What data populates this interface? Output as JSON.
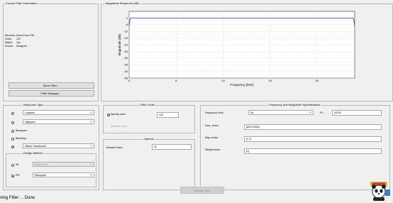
{
  "current_filter": {
    "title": "Current Filter Information",
    "rows": [
      {
        "key": "Structure:",
        "value": "Direct-Form FIR"
      },
      {
        "key": "Order:",
        "value": "120"
      },
      {
        "key": "Stable:",
        "value": "Yes"
      },
      {
        "key": "Source:",
        "value": "Designed"
      }
    ],
    "store_filter": "Store Filter ...",
    "filter_manager": "Filter Manager ..."
  },
  "magnitude": {
    "title": "Magnitude Response (dB)",
    "chart_data": {
      "type": "line",
      "xlabel": "Frequency (kHz)",
      "ylabel": "Magnitude (dB)",
      "xlim": [
        0,
        24
      ],
      "ylim": [
        -45,
        5
      ],
      "xticks": [
        0,
        5,
        10,
        15,
        20
      ],
      "yticks": [
        0,
        -5,
        -10,
        -15,
        -20,
        -25,
        -30,
        -35,
        -40,
        -45
      ],
      "grid": true,
      "series": [
        {
          "x": [
            0,
            0.1,
            0.2,
            0.3,
            1,
            5,
            10,
            15,
            20,
            23.7,
            23.8,
            23.9,
            24
          ],
          "y": [
            -6,
            -1,
            0,
            0,
            0,
            0,
            0,
            0,
            0,
            0,
            0,
            -1,
            -6
          ]
        }
      ]
    }
  },
  "response_type": {
    "title": "Response Type",
    "lowpass": "Lowpass",
    "highpass": "Highpass",
    "bandpass": "Bandpass",
    "bandstop": "Bandstop",
    "transformer": "Hilbert Transformer"
  },
  "design_method": {
    "title": "Design Method",
    "iir_label": "IIR",
    "iir_value": "Butterworth",
    "fir_label": "FIR",
    "fir_value": "Equiripple"
  },
  "filter_order": {
    "title": "Filter Order",
    "specify": "Specify order:",
    "specify_value": "120",
    "minimum": "Minimum order"
  },
  "options": {
    "title": "Options",
    "density_label": "Density Factor:",
    "density_value": "20"
  },
  "freq_mag": {
    "title": "Frequency and Magnitude Specifications",
    "units_label": "Frequency Units:",
    "units_value": "Hz",
    "fs_label": "Fs:",
    "fs_value": "44100",
    "freq_vector_label": "Freq. vector:",
    "freq_vector_value": "[600 21900]",
    "mag_vector_label": "Mag. vector:",
    "mag_vector_value": "[1 1]",
    "weight_vector_label": "Weight vector:",
    "weight_vector_value": "[1]"
  },
  "design_button": "Design Filter",
  "status": "ning Filter ... Done"
}
